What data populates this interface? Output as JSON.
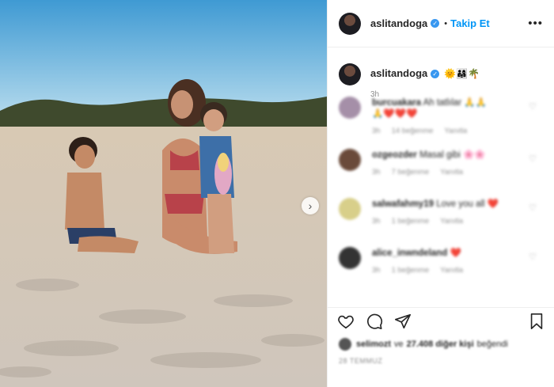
{
  "header": {
    "username": "aslitandoga",
    "follow_separator": "•",
    "follow_label": "Takip Et",
    "more_label": "•••"
  },
  "caption": {
    "username": "aslitandoga",
    "emoji": "🌞👨‍👩‍👧🌴",
    "time": "3h"
  },
  "comments": [
    {
      "user": "burcuakara",
      "text": "Ah tatlılar 🙏🙏",
      "text2": "🙏❤️❤️❤️",
      "time": "3h",
      "likes": "14 beğenme",
      "reply": "Yanıtla",
      "avatar_color": "#a58fa8"
    },
    {
      "user": "ozgeozder",
      "text": "Masal gibi 🌸🌸",
      "text2": "",
      "time": "3h",
      "likes": "7 beğenme",
      "reply": "Yanıtla",
      "avatar_color": "#6a4a3a"
    },
    {
      "user": "salwafahmy19",
      "text": "Love you all ❤️",
      "text2": "",
      "time": "3h",
      "likes": "1 beğenme",
      "reply": "Yanıtla",
      "avatar_color": "#d8cf8a"
    },
    {
      "user": "alice_inwndeland",
      "text": "❤️",
      "text2": "",
      "time": "3h",
      "likes": "1 beğenme",
      "reply": "Yanıtla",
      "avatar_color": "#333333"
    }
  ],
  "likes": {
    "liker": "selimozt",
    "and": "ve",
    "others": "27.408 diğer kişi",
    "suffix": "beğendi"
  },
  "date": "28 TEMMUZ",
  "icons": {
    "like": "heart-icon",
    "comment": "comment-icon",
    "share": "share-icon",
    "save": "bookmark-icon",
    "next": "chevron-right-icon"
  }
}
